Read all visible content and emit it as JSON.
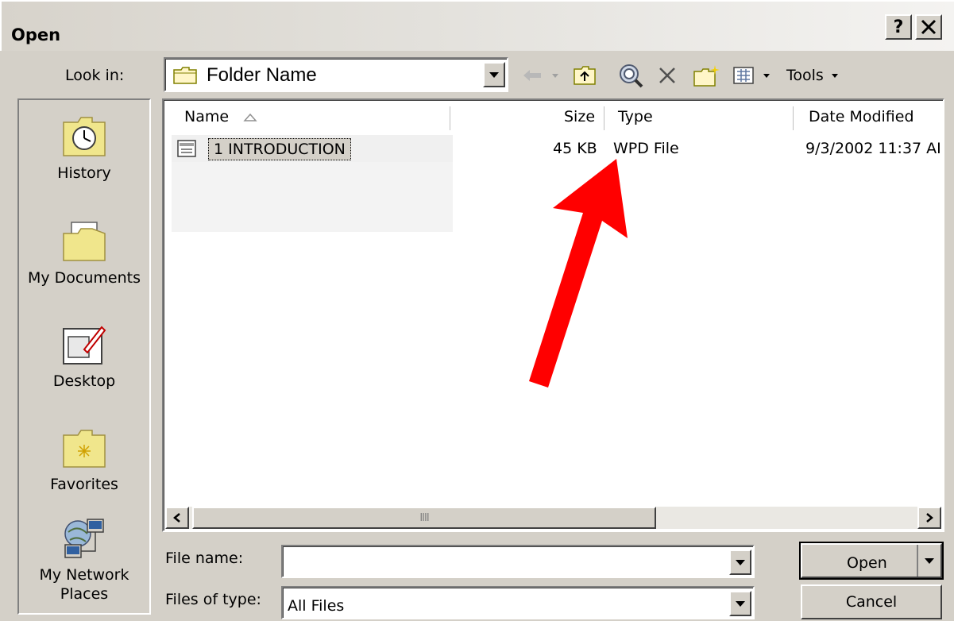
{
  "window": {
    "title": "Open"
  },
  "titlebar": {
    "help_label": "?",
    "close_label": "✕"
  },
  "lookin": {
    "label": "Look in:",
    "value": "Folder Name"
  },
  "toolbar": {
    "tools_label": "Tools"
  },
  "places": [
    {
      "label": "History"
    },
    {
      "label": "My Documents"
    },
    {
      "label": "Desktop"
    },
    {
      "label": "Favorites"
    },
    {
      "label_line1": "My Network",
      "label_line2": "Places"
    }
  ],
  "filelist": {
    "columns": [
      "Name",
      "Size",
      "Type",
      "Date Modified"
    ],
    "rows": [
      {
        "name": "1 INTRODUCTION",
        "size": "45 KB",
        "type": "WPD File",
        "date": "9/3/2002 11:37 AI"
      }
    ],
    "scroll_grip": "IIII"
  },
  "form": {
    "filename_label": "File name:",
    "filename_value": "",
    "filetype_label": "Files of type:",
    "filetype_value": "All Files"
  },
  "buttons": {
    "open": "Open",
    "cancel": "Cancel"
  },
  "colors": {
    "arrow": "#ff0000",
    "face": "#d4d0c8"
  }
}
